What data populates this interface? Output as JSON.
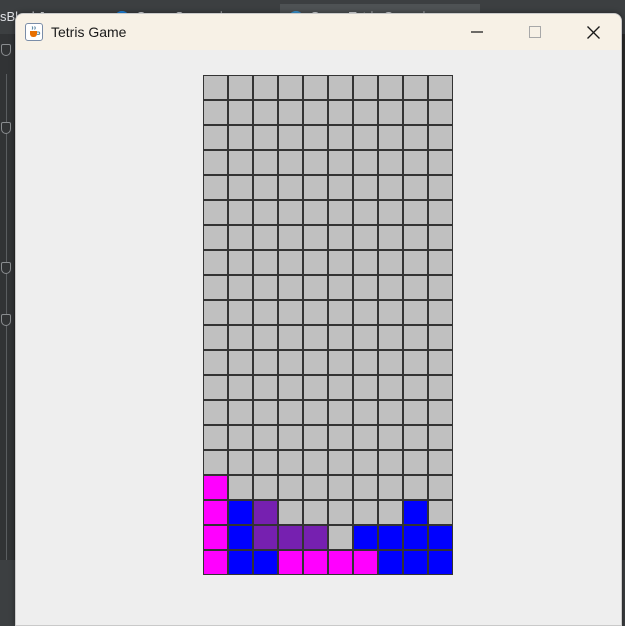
{
  "background": {
    "tabs": [
      {
        "label": "sBlockJava"
      },
      {
        "label": "Game Screen.java"
      },
      {
        "label": "Game Tetris Game.java"
      }
    ],
    "tab_dot_colors": [
      "#1e88e5",
      "#3a9ad9"
    ]
  },
  "window": {
    "title": "Tetris Game",
    "icon": "java-cup-icon",
    "controls": [
      {
        "name": "minimize",
        "icon": "minimize-icon"
      },
      {
        "name": "maximize",
        "icon": "maximize-icon"
      },
      {
        "name": "close",
        "icon": "close-icon"
      }
    ]
  },
  "board": {
    "columns": 10,
    "rows": 20,
    "colors": {
      "E": "#c0c0c0",
      "M": "#ff00ff",
      "B": "#0000ff",
      "P": "#7620b0"
    },
    "grid": [
      "EEEEEEEEEE",
      "EEEEEEEEEE",
      "EEEEEEEEEE",
      "EEEEEEEEEE",
      "EEEEEEEEEE",
      "EEEEEEEEEE",
      "EEEEEEEEEE",
      "EEEEEEEEEE",
      "EEEEEEEEEE",
      "EEEEEEEEEE",
      "EEEEEEEEEE",
      "EEEEEEEEEE",
      "EEEEEEEEEE",
      "EEEEEEEEEE",
      "EEEEEEEEEE",
      "EEEEEEEEEE",
      "MEEEEEEEEE",
      "MBPEEEEEBE",
      "MBPPPEBBBB",
      "MBBMMMMBBB"
    ]
  }
}
